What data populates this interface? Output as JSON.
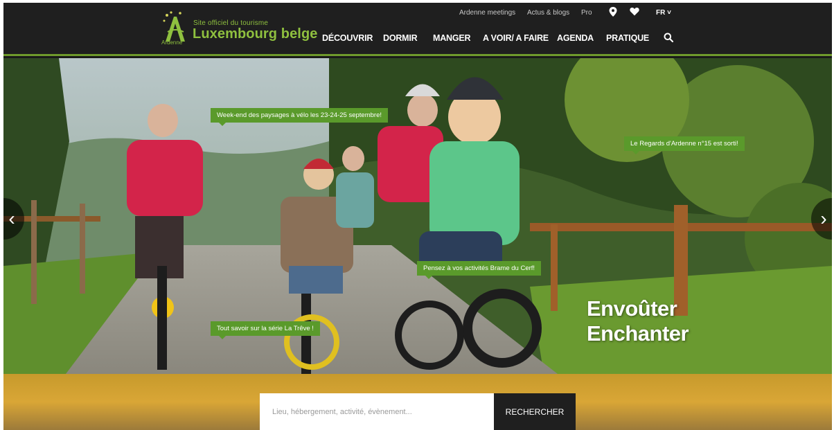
{
  "header": {
    "logo": {
      "subtitle": "Site officiel du tourisme",
      "name": "Luxembourg belge",
      "region": "Ardenne"
    },
    "utility": {
      "links": [
        "Ardenne meetings",
        "Actus & blogs",
        "Pro"
      ],
      "language": "FR ˅"
    },
    "nav": [
      "DÉCOUVRIR",
      "DORMIR",
      "MANGER",
      "A VOIR/ A FAIRE",
      "AGENDA",
      "PRATIQUE"
    ],
    "icons": {
      "location": "map-pin-icon",
      "favorites": "heart-icon",
      "search": "search-icon"
    }
  },
  "hero": {
    "tags": [
      "Week-end des paysages à vélo les 23-24-25 septembre!",
      "Le Regards d'Ardenne n°15 est sorti!",
      "Pensez à vos activités Brame du Cerf!",
      "Tout savoir sur la série La Trêve !"
    ],
    "slogan_line1": "Envoûter",
    "slogan_line2": "Enchanter",
    "prev": "‹",
    "next": "›"
  },
  "search": {
    "placeholder": "Lieu, hébergement, activité, évènement...",
    "button": "RECHERCHER"
  },
  "colors": {
    "accent": "#6f9a2c",
    "tag": "#5a9a2b",
    "band": "#d9a636",
    "header": "#1f1f1f"
  }
}
